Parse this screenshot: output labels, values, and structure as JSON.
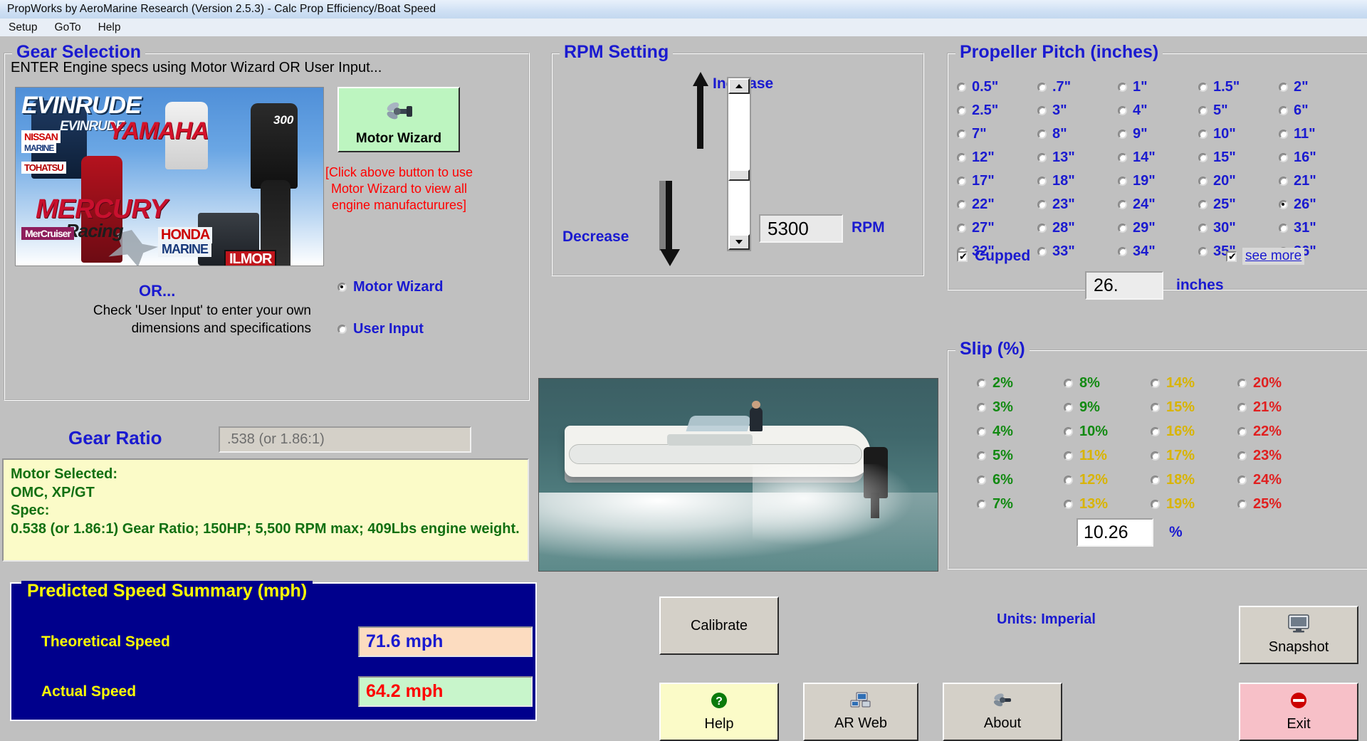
{
  "window": {
    "title": "PropWorks by AeroMarine Research (Version 2.5.3) - Calc Prop Efficiency/Boat Speed",
    "menu": [
      "Setup",
      "GoTo",
      "Help"
    ]
  },
  "gear_selection": {
    "legend": "Gear Selection",
    "subtitle": "ENTER Engine specs using Motor Wizard OR User Input...",
    "motor_image_brands": {
      "evinrude": "EVINRUDE",
      "evinrude_sub": "EVINRUDE",
      "yamaha": "YAMAHA",
      "mercury": "MERCURY",
      "racing": "Racing",
      "nissan": "NISSAN",
      "nissan_marine": "MARINE",
      "tohatsu": "TOHATSU",
      "honda": "HONDA",
      "honda_marine": "MARINE",
      "ilmor": "ILMOR",
      "mercruiser": "MerCruiser",
      "hp_badge": "300"
    },
    "motor_wizard_button": "Motor Wizard",
    "motor_wizard_note": "[Click above button to use Motor Wizard to view all engine manufacturures]",
    "or_text": "OR...",
    "user_input_note": "Check 'User Input' to enter your own dimensions and specifications",
    "radios": [
      {
        "label": "Motor Wizard",
        "selected": true
      },
      {
        "label": "User Input",
        "selected": false
      }
    ]
  },
  "gear_ratio": {
    "label": "Gear Ratio",
    "value": ".538 (or 1.86:1)"
  },
  "motor_spec": {
    "line1": "Motor Selected:",
    "line2": "OMC, XP/GT",
    "line3": "Spec:",
    "line4": "0.538 (or 1.86:1) Gear Ratio; 150HP; 5,500 RPM max; 409Lbs engine weight."
  },
  "speed_summary": {
    "legend": "Predicted Speed Summary (mph)",
    "theoretical_label": "Theoretical Speed",
    "theoretical_value": "71.6 mph",
    "actual_label": "Actual Speed",
    "actual_value": "64.2 mph"
  },
  "rpm": {
    "legend": "RPM Setting",
    "increase_label": "Increase",
    "decrease_label": "Decrease",
    "value": "5300",
    "unit": "RPM"
  },
  "pitch": {
    "legend": "Propeller Pitch (inches)",
    "options": [
      [
        "0.5\"",
        ".7\"",
        "1\"",
        "1.5\"",
        "2\""
      ],
      [
        "2.5\"",
        "3\"",
        "4\"",
        "5\"",
        "6\""
      ],
      [
        "7\"",
        "8\"",
        "9\"",
        "10\"",
        "11\""
      ],
      [
        "12\"",
        "13\"",
        "14\"",
        "15\"",
        "16\""
      ],
      [
        "17\"",
        "18\"",
        "19\"",
        "20\"",
        "21\""
      ],
      [
        "22\"",
        "23\"",
        "24\"",
        "25\"",
        "26\""
      ],
      [
        "27\"",
        "28\"",
        "29\"",
        "30\"",
        "31\""
      ],
      [
        "32\"",
        "33\"",
        "34\"",
        "35\"",
        "36\""
      ]
    ],
    "selected": "26\"",
    "cupped_label": "Cupped",
    "cupped_checked": true,
    "see_more_checked": true,
    "see_more_label": "see more",
    "value": "26.",
    "unit": "inches"
  },
  "slip": {
    "legend": "Slip (%)",
    "columns": [
      {
        "color": "#128a12",
        "values": [
          "2%",
          "3%",
          "4%",
          "5%",
          "6%",
          "7%"
        ]
      },
      {
        "color": "#128a12",
        "values": [
          "8%",
          "9%",
          "10%",
          "11%",
          "12%",
          "13%"
        ]
      },
      {
        "color": "#d9b400",
        "values": [
          "14%",
          "15%",
          "16%",
          "17%",
          "18%",
          "19%"
        ]
      },
      {
        "color": "#e02020",
        "values": [
          "20%",
          "21%",
          "22%",
          "23%",
          "24%",
          "25%"
        ]
      }
    ],
    "column_color_overrides": {
      "c1_green_upto": 4,
      "c1_yellow_from": 4,
      "c2_yellow_upto": 3,
      "c2_green_upto": 3
    },
    "value": "10.26",
    "unit": "%"
  },
  "buttons": {
    "calibrate": "Calibrate",
    "help": "Help",
    "ar_web": "AR Web",
    "about": "About",
    "snapshot": "Snapshot",
    "exit": "Exit"
  },
  "units": {
    "label": "Units:  Imperial"
  }
}
